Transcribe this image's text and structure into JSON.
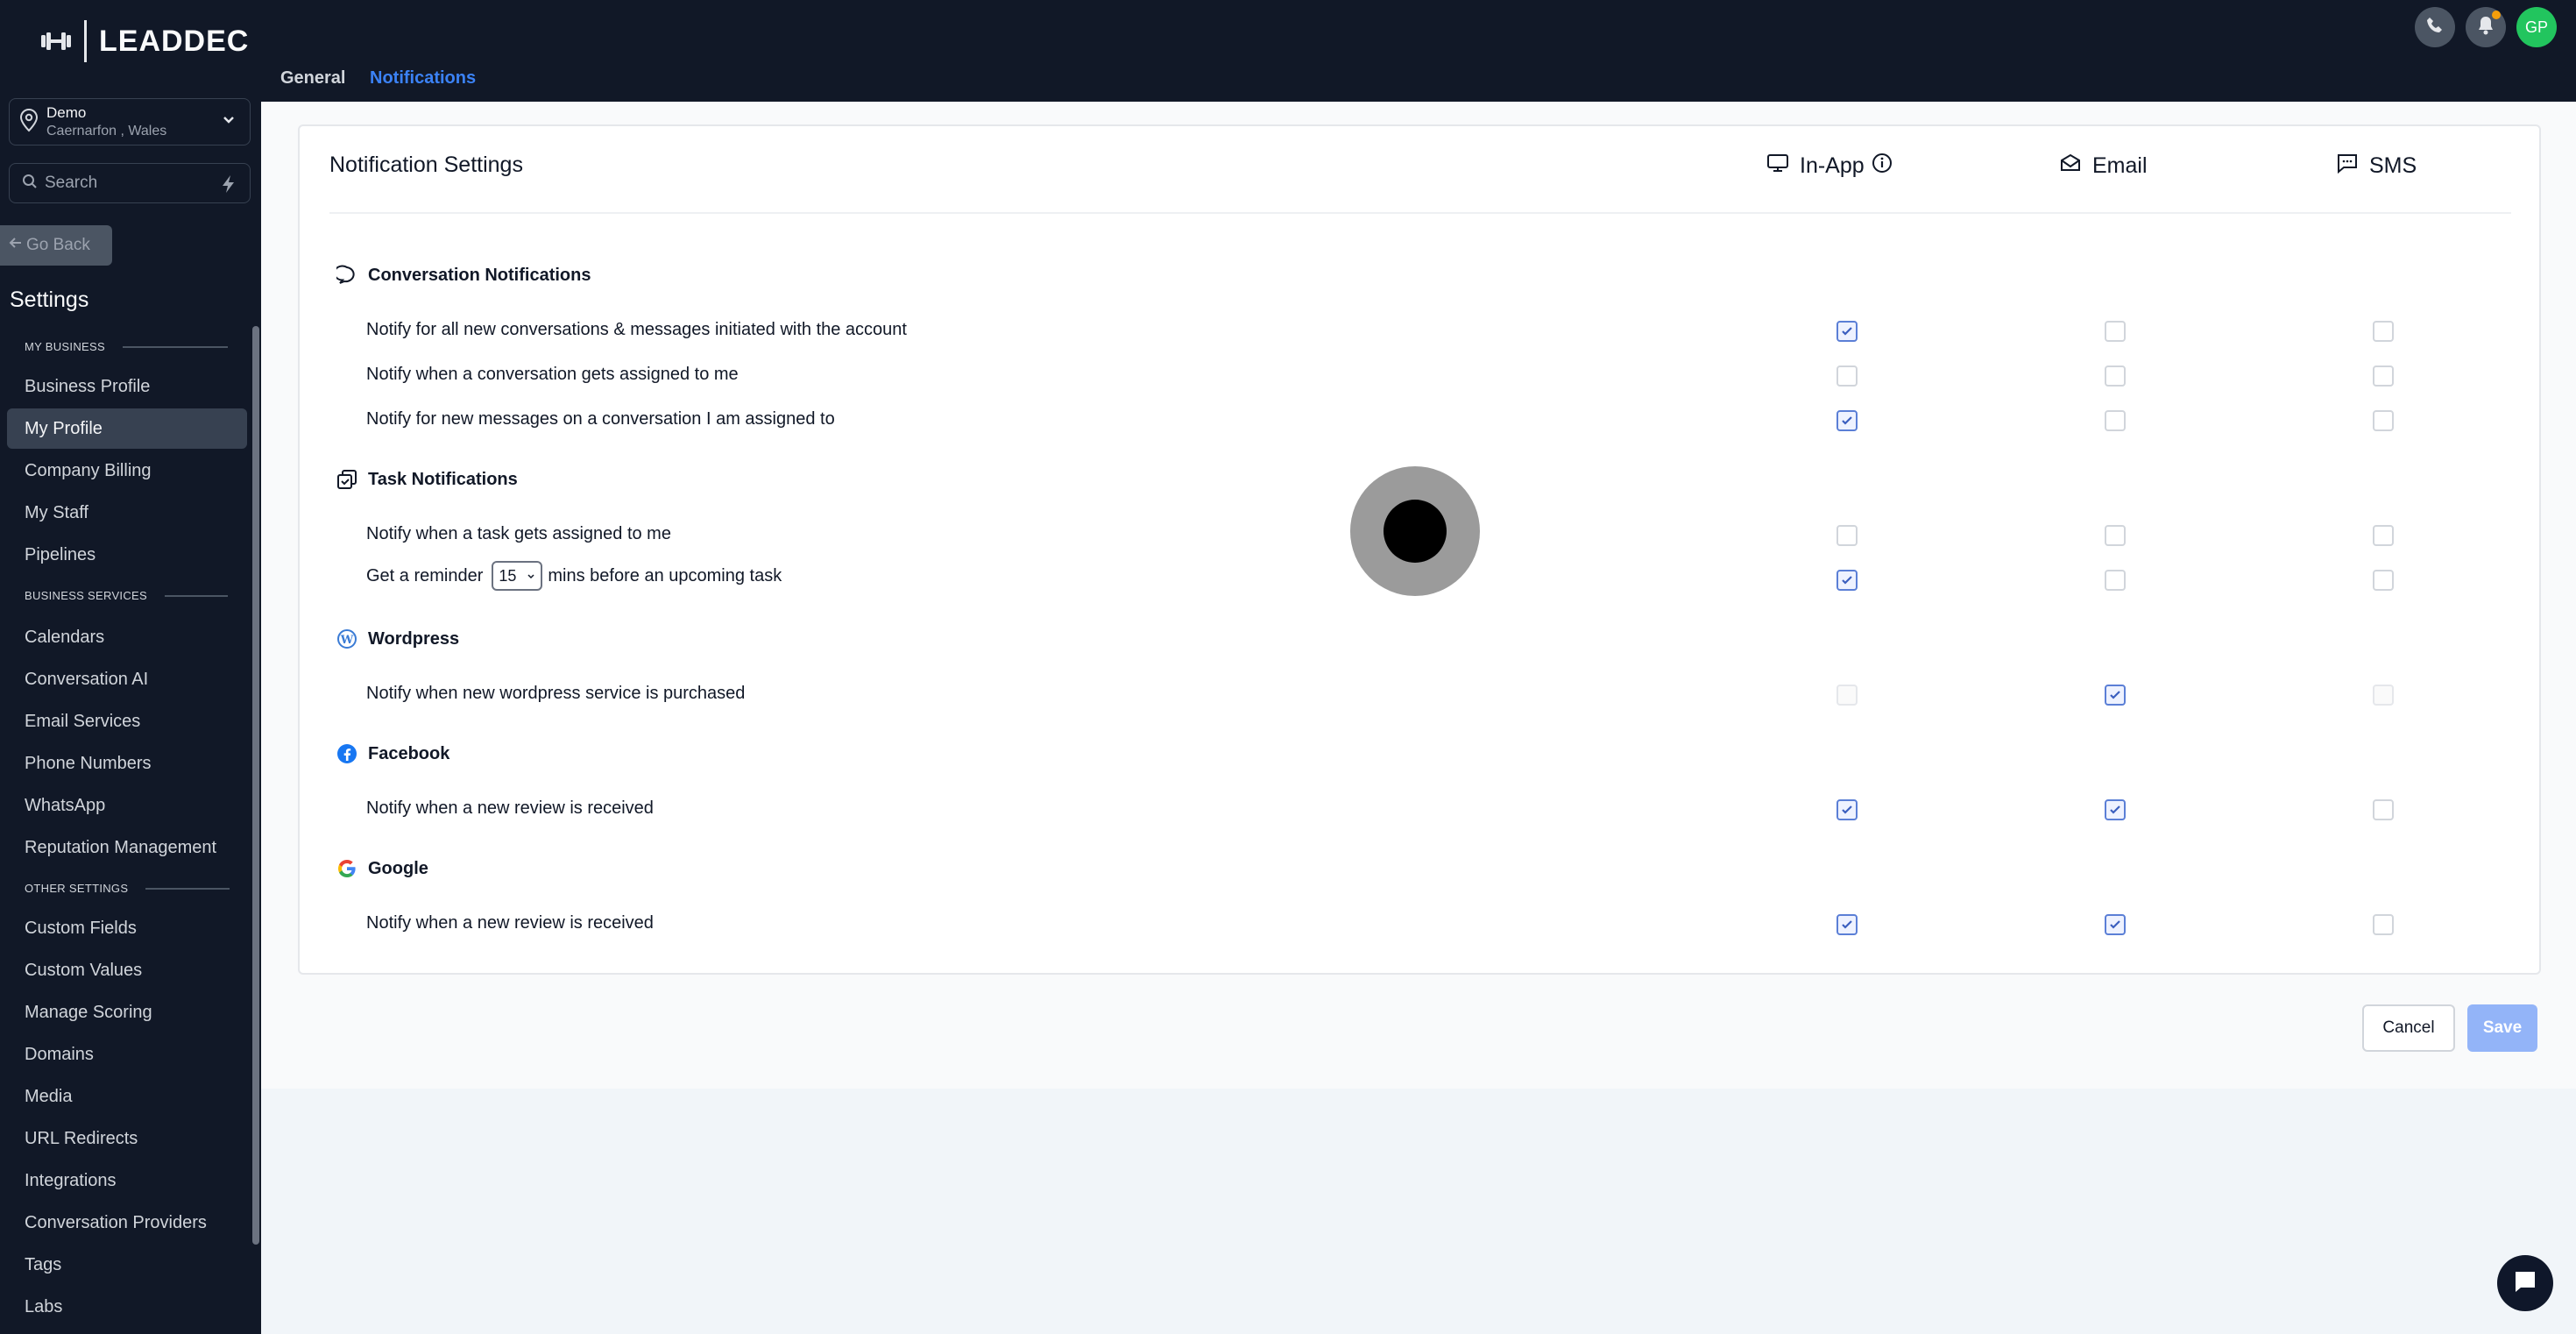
{
  "brand": {
    "name": "LEADDEC"
  },
  "location": {
    "name": "Demo",
    "subtitle": "Caernarfon , Wales"
  },
  "search": {
    "placeholder": "Search"
  },
  "sidebar": {
    "go_back": "Go Back",
    "title": "Settings",
    "groups": [
      {
        "header": "MY BUSINESS",
        "items": [
          "Business Profile",
          "My Profile",
          "Company Billing",
          "My Staff",
          "Pipelines"
        ]
      },
      {
        "header": "BUSINESS SERVICES",
        "items": [
          "Calendars",
          "Conversation AI",
          "Email Services",
          "Phone Numbers",
          "WhatsApp",
          "Reputation Management"
        ]
      },
      {
        "header": "OTHER SETTINGS",
        "items": [
          "Custom Fields",
          "Custom Values",
          "Manage Scoring",
          "Domains",
          "Media",
          "URL Redirects",
          "Integrations",
          "Conversation Providers",
          "Tags",
          "Labs"
        ]
      }
    ],
    "active_item": "My Profile"
  },
  "tabs": {
    "general": "General",
    "notifications": "Notifications"
  },
  "header": {
    "avatar_initials": "GP"
  },
  "card": {
    "title": "Notification Settings",
    "channels": {
      "inapp": "In-App",
      "email": "Email",
      "sms": "SMS"
    }
  },
  "sections": {
    "conversation": {
      "title": "Conversation Notifications",
      "rows": [
        {
          "label": "Notify for all new conversations & messages initiated with the account",
          "inapp": true,
          "email": false,
          "sms": false
        },
        {
          "label": "Notify when a conversation gets assigned to me",
          "inapp": false,
          "email": false,
          "sms": false
        },
        {
          "label": "Notify for new messages on a conversation I am assigned to",
          "inapp": true,
          "email": false,
          "sms": false
        }
      ]
    },
    "task": {
      "title": "Task Notifications",
      "rows": [
        {
          "label": "Notify when a task gets assigned to me",
          "inapp": false,
          "email": false,
          "sms": false
        },
        {
          "label_prefix": "Get a reminder",
          "select_value": "15",
          "label_suffix": "mins before an upcoming task",
          "inapp": true,
          "email": false,
          "sms": false
        }
      ]
    },
    "wordpress": {
      "title": "Wordpress",
      "rows": [
        {
          "label": "Notify when new wordpress service is purchased",
          "inapp": false,
          "email": true,
          "sms": false,
          "inapp_disabled": true,
          "sms_disabled": true
        }
      ]
    },
    "facebook": {
      "title": "Facebook",
      "rows": [
        {
          "label": "Notify when a new review is received",
          "inapp": true,
          "email": true,
          "sms": false
        }
      ]
    },
    "google": {
      "title": "Google",
      "rows": [
        {
          "label": "Notify when a new review is received",
          "inapp": true,
          "email": true,
          "sms": false
        }
      ]
    }
  },
  "actions": {
    "cancel": "Cancel",
    "save": "Save"
  },
  "colors": {
    "sidebar_bg": "#111827",
    "accent": "#3b82f6",
    "save_disabled": "#93b4f8",
    "avatar": "#22c55e"
  }
}
